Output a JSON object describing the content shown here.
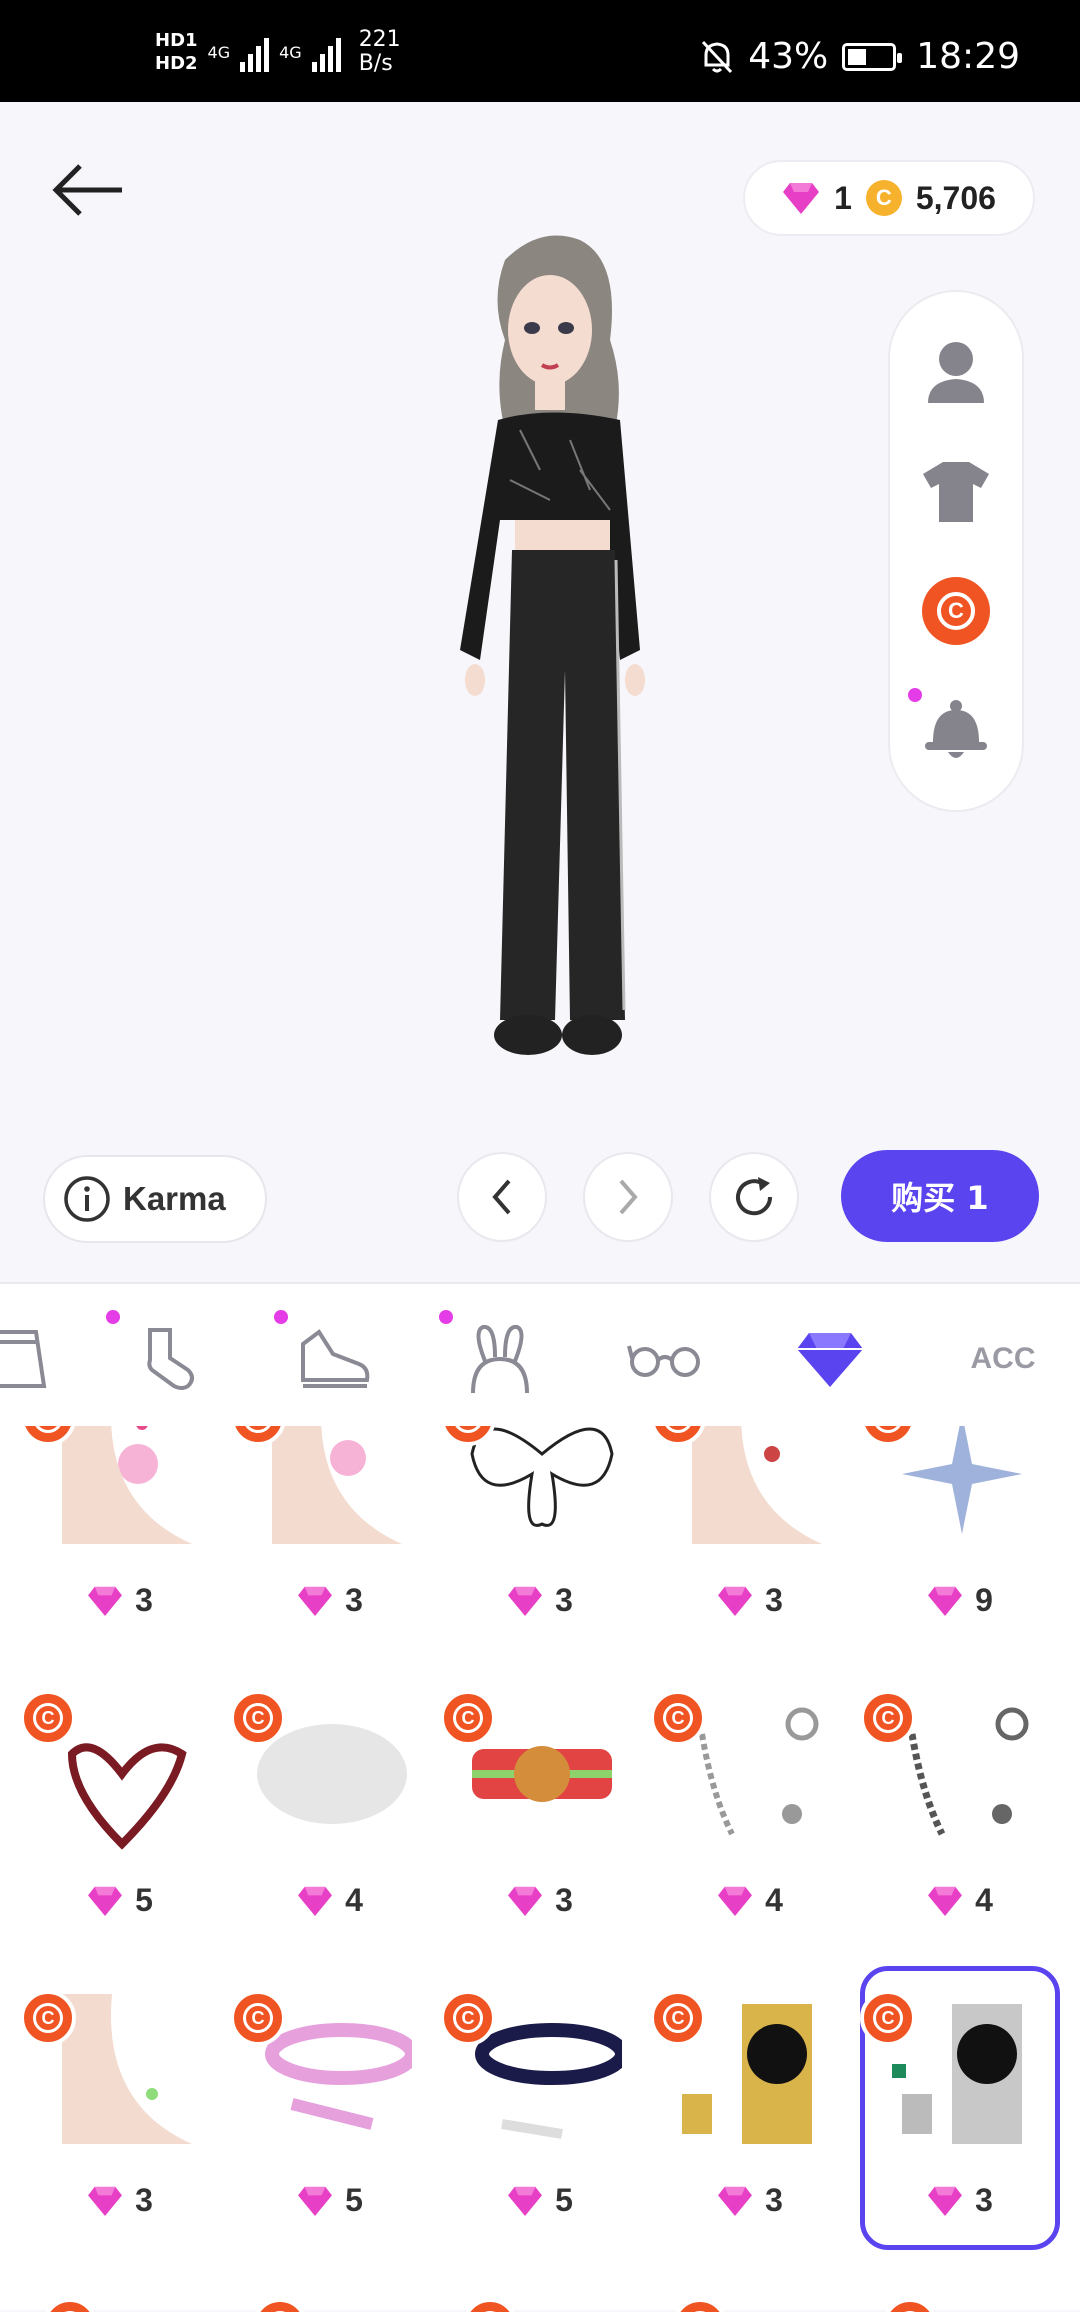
{
  "status": {
    "hd1": "HD1",
    "hd2": "HD2",
    "net1": "4G",
    "net2": "4G",
    "speed_value": "221",
    "speed_unit": "B/s",
    "battery": "43%",
    "battery_level": 0.43,
    "time": "18:29"
  },
  "header": {
    "back_icon": "arrow-left-icon",
    "gems": "1",
    "coins": "5,706",
    "gem_color": "#e73fc6",
    "coin_color": "#f6b22c"
  },
  "sidebar": {
    "items": [
      {
        "name": "avatar-body-icon"
      },
      {
        "name": "tshirt-icon"
      },
      {
        "name": "creator-c-icon",
        "active": true
      },
      {
        "name": "bell-icon",
        "dot": true
      }
    ]
  },
  "controls": {
    "karma": "Karma",
    "buy": "购买 1",
    "accent": "#5a44f0"
  },
  "categories": [
    {
      "name": "skirt-icon"
    },
    {
      "name": "sock-icon",
      "dot": true
    },
    {
      "name": "sneaker-icon",
      "dot": true
    },
    {
      "name": "bunny-ears-icon",
      "dot": true
    },
    {
      "name": "glasses-icon"
    },
    {
      "name": "diamond-icon",
      "active": true
    },
    {
      "name": "acc-tab",
      "label": "ACC"
    }
  ],
  "items": [
    {
      "price": "3"
    },
    {
      "price": "3"
    },
    {
      "price": "3"
    },
    {
      "price": "3"
    },
    {
      "price": "9"
    },
    {
      "price": "5"
    },
    {
      "price": "4"
    },
    {
      "price": "3"
    },
    {
      "price": "4"
    },
    {
      "price": "4"
    },
    {
      "price": "3"
    },
    {
      "price": "5"
    },
    {
      "price": "5"
    },
    {
      "price": "3"
    },
    {
      "price": "3"
    }
  ]
}
